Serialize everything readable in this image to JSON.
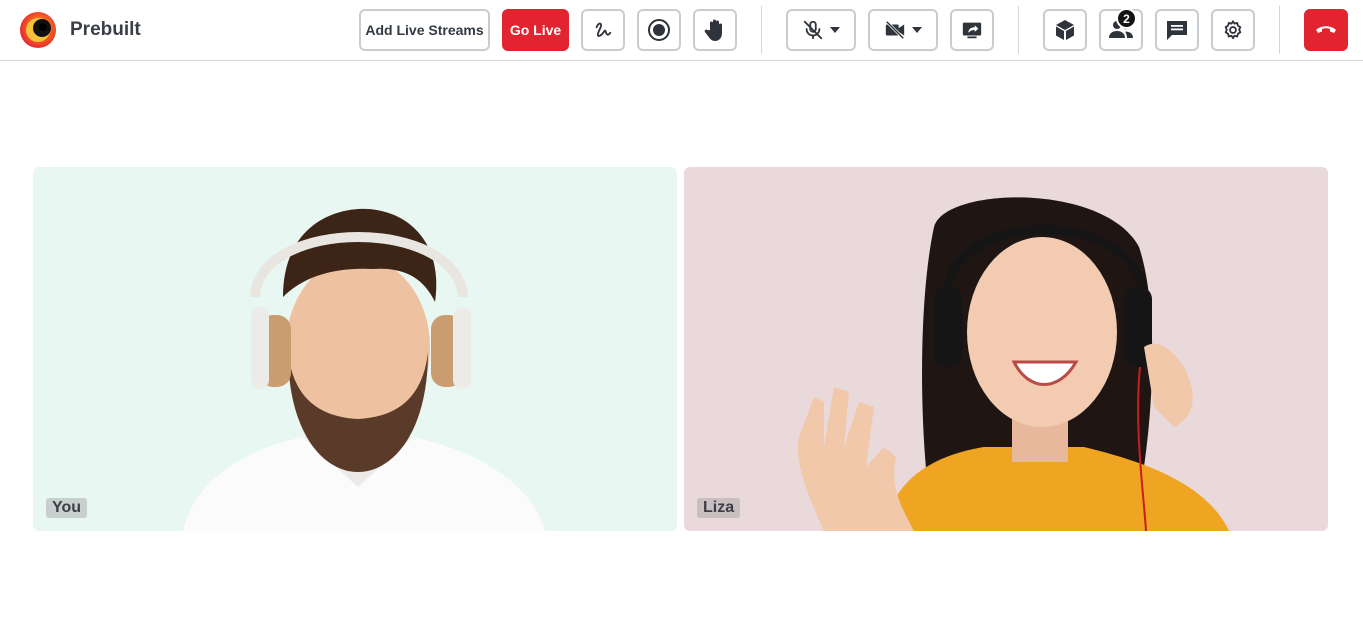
{
  "app": {
    "brand_name": "Prebuilt"
  },
  "toolbar": {
    "add_live_streams_label": "Add Live Streams",
    "go_live_label": "Go Live",
    "whiteboard_icon": "whiteboard-icon",
    "record_icon": "record-icon",
    "raise_hand_icon": "raise-hand-icon",
    "mic_icon": "mic-off-icon",
    "camera_icon": "camera-off-icon",
    "screen_share_icon": "screen-share-icon",
    "apps_icon": "cube-icon",
    "participants_icon": "participants-icon",
    "participants_count": "2",
    "chat_icon": "chat-icon",
    "settings_icon": "gear-icon",
    "leave_icon": "hang-up-icon"
  },
  "colors": {
    "accent_red": "#e1242f",
    "tile_you_bg": "#e8f7f2",
    "tile_liza_bg": "#e9d9da"
  },
  "participants": [
    {
      "name": "You"
    },
    {
      "name": "Liza"
    }
  ]
}
